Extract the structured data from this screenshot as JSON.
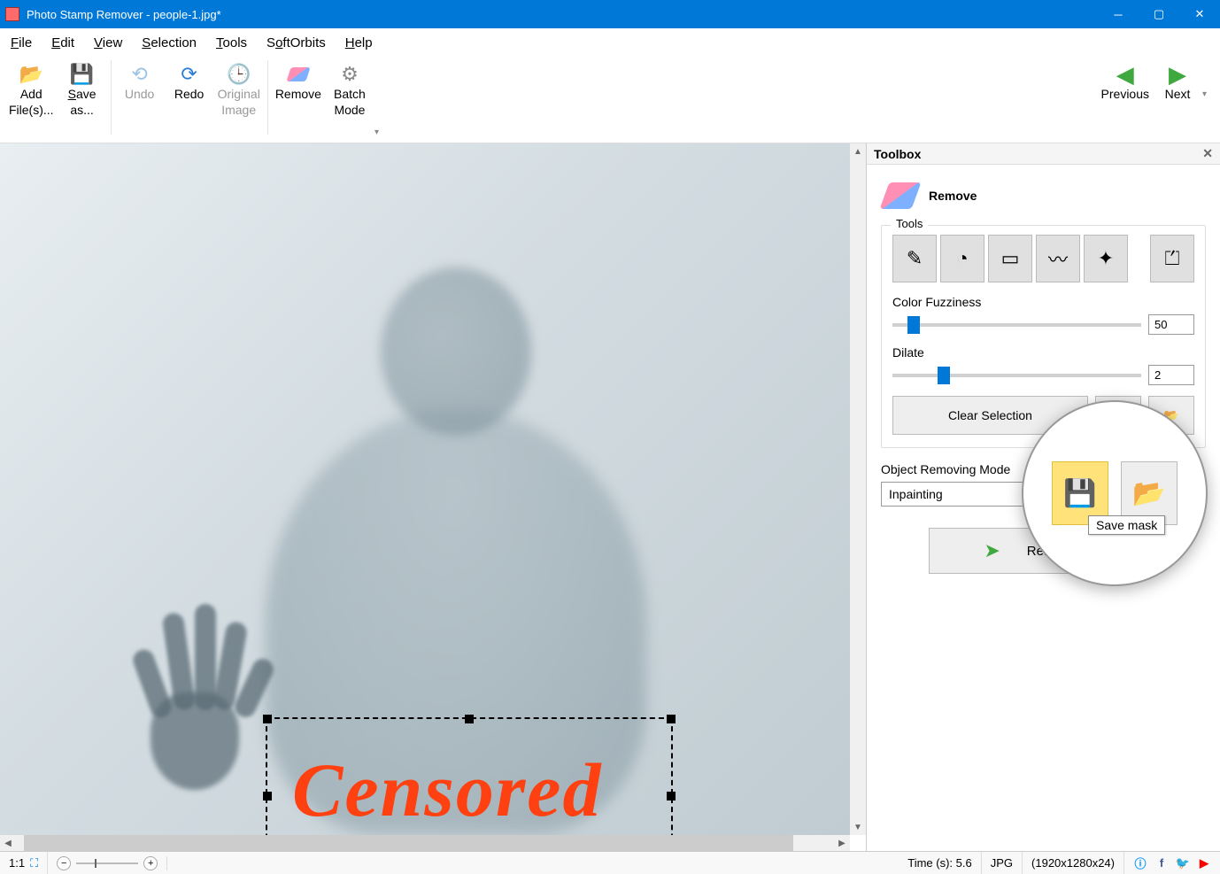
{
  "window": {
    "title": "Photo Stamp Remover - people-1.jpg*"
  },
  "menu": {
    "file": "File",
    "edit": "Edit",
    "view": "View",
    "selection": "Selection",
    "tools": "Tools",
    "softorbits": "SoftOrbits",
    "help": "Help"
  },
  "toolbar": {
    "add_files": "Add File(s)...",
    "save_as": "Save as...",
    "undo": "Undo",
    "redo": "Redo",
    "original_image": "Original Image",
    "remove": "Remove",
    "batch_mode": "Batch Mode",
    "previous": "Previous",
    "next": "Next"
  },
  "canvas": {
    "watermark_text": "Censored"
  },
  "toolbox": {
    "panel_title": "Toolbox",
    "section_title": "Remove",
    "tools_label": "Tools",
    "color_fuzziness_label": "Color Fuzziness",
    "color_fuzziness_value": "50",
    "dilate_label": "Dilate",
    "dilate_value": "2",
    "clear_selection": "Clear Selection",
    "object_removing_mode_label": "Object Removing Mode",
    "object_removing_mode_value": "Inpainting",
    "remove_btn": "Remove",
    "tooltip_save_mask": "Save mask"
  },
  "statusbar": {
    "zoom_label": "1:1",
    "time": "Time (s): 5.6",
    "format": "JPG",
    "dimensions": "(1920x1280x24)"
  }
}
